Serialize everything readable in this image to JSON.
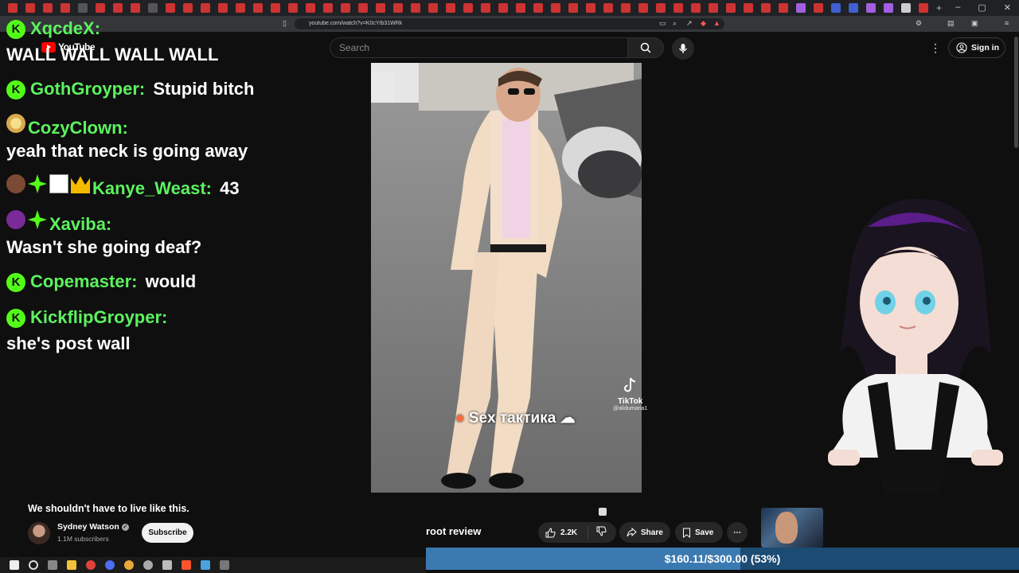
{
  "browser": {
    "url": "youtube.com/watch?v=K0cYIb31WRk"
  },
  "youtube": {
    "logo_text": "YouTube",
    "search_placeholder": "Search",
    "signin_label": "Sign in"
  },
  "chat": {
    "messages": [
      {
        "user": "XqcdeX:",
        "text": "WALL WALL WALL WALL"
      },
      {
        "user": "GothGroyper:",
        "text": "Stupid bitch"
      },
      {
        "user": "CozyClown:",
        "text": "yeah that neck is going away"
      },
      {
        "user": "Kanye_Weast:",
        "text": "43"
      },
      {
        "user": "Xaviba:",
        "text": "Wasn't she going deaf?"
      },
      {
        "user": "Copemaster:",
        "text": "would"
      },
      {
        "user": "KickflipGroyper:",
        "text": "she's post wall"
      }
    ],
    "badge_letter": "K"
  },
  "video": {
    "watermark": "TikTok",
    "watermark_user": "@alidumaria1",
    "caption": "Sex тактика"
  },
  "info": {
    "title": "We shouldn't have to live like this.",
    "channel": "Sydney Watson",
    "subscribers": "1.1M subscribers",
    "subscribe_label": "Subscribe",
    "overlay_label": "root review",
    "likes": "2.2K",
    "share_label": "Share",
    "save_label": "Save"
  },
  "donation": {
    "text": "$160.11/$300.00 (53%)",
    "progress": 0.53
  },
  "colors": {
    "chat_name": "#5cf25f",
    "kick_badge": "#53fc18",
    "donation_bg": "#1c4b73",
    "donation_fill": "#3b7ab1"
  }
}
